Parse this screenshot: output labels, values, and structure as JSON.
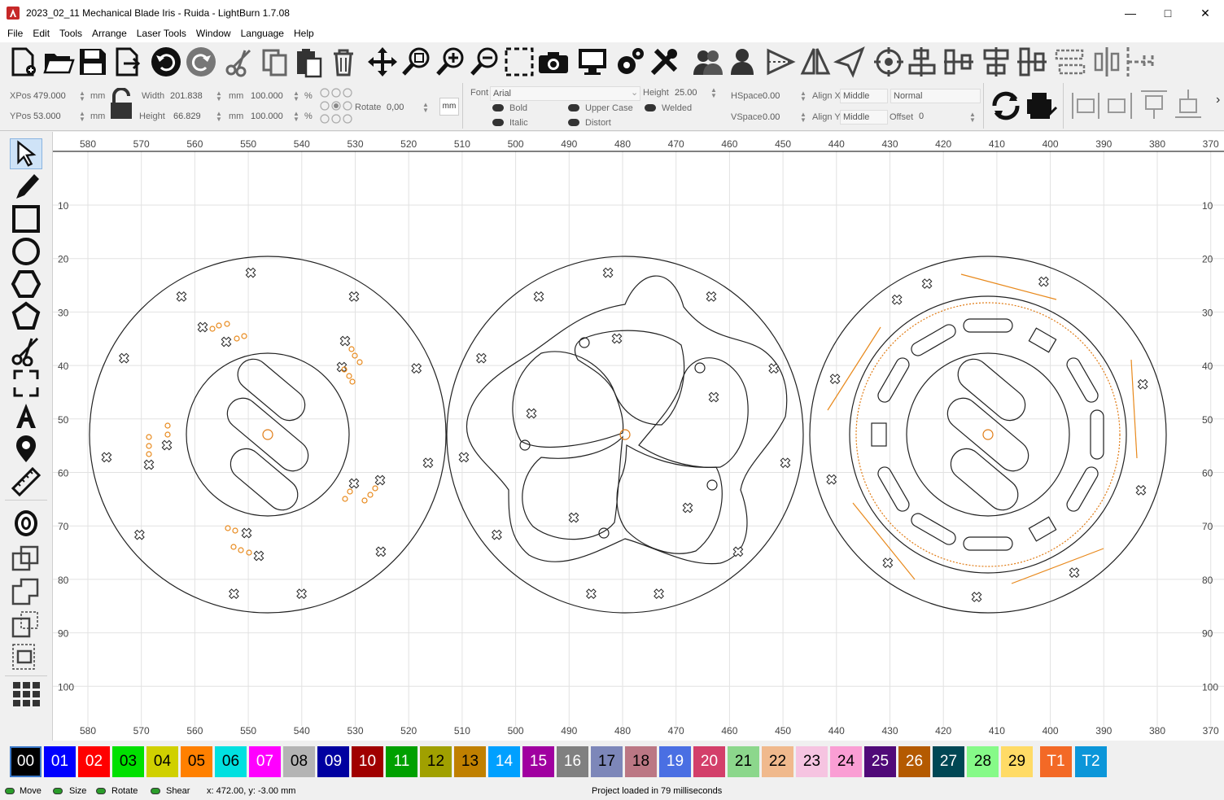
{
  "titlebar": {
    "title": "2023_02_11 Mechanical Blade Iris - Ruida - LightBurn 1.7.08",
    "minimize_icon": "minimize-icon",
    "maximize_icon": "maximize-icon",
    "close_icon": "close-icon"
  },
  "menubar": {
    "items": [
      "File",
      "Edit",
      "Tools",
      "Arrange",
      "Laser Tools",
      "Window",
      "Language",
      "Help"
    ]
  },
  "toolbar": {
    "icons": [
      "new-file-icon",
      "open-folder-icon",
      "save-icon",
      "import-icon",
      "undo-icon",
      "redo-icon",
      "cut-icon",
      "copy-icon",
      "paste-icon",
      "delete-icon",
      "move-icon",
      "zoom-selection-icon",
      "zoom-in-icon",
      "zoom-out-icon",
      "frame-icon",
      "camera-icon",
      "monitor-icon",
      "settings-icon",
      "tools-icon",
      "group-icon",
      "user-icon",
      "mirror-h-icon",
      "mirror-v-icon",
      "send-icon",
      "target-icon",
      "align-left-icon",
      "align-center-icon",
      "align-top-icon",
      "align-middle-icon",
      "distribute-h-icon",
      "distribute-v-icon",
      "spacing-icon"
    ]
  },
  "props": {
    "xpos_label": "XPos",
    "xpos_value": "479.000",
    "xpos_unit": "mm",
    "ypos_label": "YPos",
    "ypos_value": "53.000",
    "ypos_unit": "mm",
    "width_label": "Width",
    "width_value": "201.838",
    "width_unit": "mm",
    "height_label": "Height",
    "height_value": "66.829",
    "height_unit": "mm",
    "scale_w": "100.000",
    "scale_h": "100.000",
    "percent": "%",
    "rotate_label": "Rotate",
    "rotate_value": "0,00",
    "mm_button": "mm",
    "font_label": "Font",
    "font_value": "Arial",
    "font_height_label": "Height",
    "font_height_value": "25.00",
    "hspace_label": "HSpace",
    "hspace_value": "0.00",
    "vspace_label": "VSpace",
    "vspace_value": "0.00",
    "alignx_label": "Align X",
    "alignx_value": "Middle",
    "aligny_label": "Align Y",
    "aligny_value": "Middle",
    "mode_value": "Normal",
    "offset_label": "Offset",
    "offset_value": "0",
    "bold": "Bold",
    "italic": "Italic",
    "upper_case": "Upper Case",
    "distort": "Distort",
    "welded": "Welded"
  },
  "ruler": {
    "x_ticks": [
      "580",
      "570",
      "560",
      "550",
      "540",
      "530",
      "520",
      "510",
      "500",
      "490",
      "480",
      "470",
      "460",
      "450",
      "440",
      "430",
      "420",
      "410",
      "400",
      "390",
      "380",
      "370"
    ],
    "y_ticks": [
      "10",
      "20",
      "30",
      "40",
      "50",
      "60",
      "70",
      "80",
      "90",
      "100"
    ]
  },
  "palette": {
    "swatches": [
      {
        "label": "00",
        "bg": "#000000",
        "fg": "#ffffff"
      },
      {
        "label": "01",
        "bg": "#0000ff",
        "fg": "#ffffff"
      },
      {
        "label": "02",
        "bg": "#ff0000",
        "fg": "#ffffff"
      },
      {
        "label": "03",
        "bg": "#00e000",
        "fg": "#000000"
      },
      {
        "label": "04",
        "bg": "#d0d000",
        "fg": "#000000"
      },
      {
        "label": "05",
        "bg": "#ff8000",
        "fg": "#000000"
      },
      {
        "label": "06",
        "bg": "#00e0e0",
        "fg": "#000000"
      },
      {
        "label": "07",
        "bg": "#ff00ff",
        "fg": "#ffffff"
      },
      {
        "label": "08",
        "bg": "#b4b4b4",
        "fg": "#000000"
      },
      {
        "label": "09",
        "bg": "#0000a0",
        "fg": "#ffffff"
      },
      {
        "label": "10",
        "bg": "#a00000",
        "fg": "#ffffff"
      },
      {
        "label": "11",
        "bg": "#00a000",
        "fg": "#ffffff"
      },
      {
        "label": "12",
        "bg": "#a0a000",
        "fg": "#000000"
      },
      {
        "label": "13",
        "bg": "#c08000",
        "fg": "#000000"
      },
      {
        "label": "14",
        "bg": "#00a0ff",
        "fg": "#ffffff"
      },
      {
        "label": "15",
        "bg": "#a000a0",
        "fg": "#ffffff"
      },
      {
        "label": "16",
        "bg": "#808080",
        "fg": "#ffffff"
      },
      {
        "label": "17",
        "bg": "#7d87b9",
        "fg": "#000000"
      },
      {
        "label": "18",
        "bg": "#bb7784",
        "fg": "#000000"
      },
      {
        "label": "19",
        "bg": "#4a6fe3",
        "fg": "#ffffff"
      },
      {
        "label": "20",
        "bg": "#d33f6a",
        "fg": "#ffffff"
      },
      {
        "label": "21",
        "bg": "#8cd78c",
        "fg": "#000000"
      },
      {
        "label": "22",
        "bg": "#f0b98d",
        "fg": "#000000"
      },
      {
        "label": "23",
        "bg": "#f6c4e1",
        "fg": "#000000"
      },
      {
        "label": "24",
        "bg": "#fa9ed4",
        "fg": "#000000"
      },
      {
        "label": "25",
        "bg": "#500a78",
        "fg": "#ffffff"
      },
      {
        "label": "26",
        "bg": "#b45a00",
        "fg": "#ffffff"
      },
      {
        "label": "27",
        "bg": "#004754",
        "fg": "#ffffff"
      },
      {
        "label": "28",
        "bg": "#86fa88",
        "fg": "#000000"
      },
      {
        "label": "29",
        "bg": "#ffdb66",
        "fg": "#000000"
      },
      {
        "label": "T1",
        "bg": "#f36926",
        "fg": "#ffffff"
      },
      {
        "label": "T2",
        "bg": "#0c96d9",
        "fg": "#ffffff"
      }
    ]
  },
  "status": {
    "move": "Move",
    "size": "Size",
    "rotate": "Rotate",
    "shear": "Shear",
    "coords": "x: 472.00, y: -3.00 mm",
    "message": "Project loaded in 79 milliseconds"
  }
}
